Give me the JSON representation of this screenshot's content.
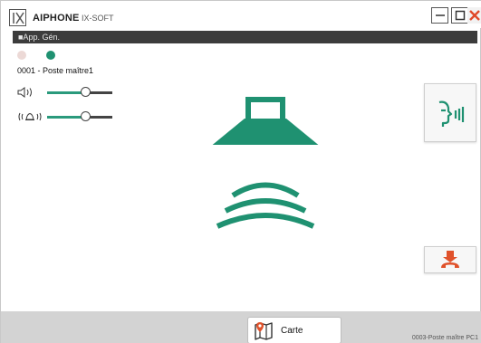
{
  "window": {
    "brand": "AIPHONE",
    "product": "IX-SOFT",
    "logo_text": "IX"
  },
  "section": {
    "title": "■App. Gén."
  },
  "status_dots": [
    {
      "state": "inactive",
      "color": "#ecd9d6"
    },
    {
      "state": "active",
      "color": "#1f9171"
    }
  ],
  "station": {
    "label": "0001 - Poste maître1"
  },
  "volume": {
    "speaker_level": 0.55,
    "ring_level": 0.55,
    "speaker_icon": "speaker-volume-icon",
    "ring_icon": "bell-volume-icon"
  },
  "buttons": {
    "talk_icon": "talk-icon",
    "end_call_icon": "end-call-icon"
  },
  "bottom": {
    "map_label": "Carte",
    "map_icon": "map-icon",
    "footer_station": "0003-Poste maître PC1"
  },
  "colors": {
    "accent": "#1f9171",
    "end_call": "#e0522b",
    "section_bar": "#3c3c3c",
    "bottom_bar": "#d3d3d3"
  }
}
